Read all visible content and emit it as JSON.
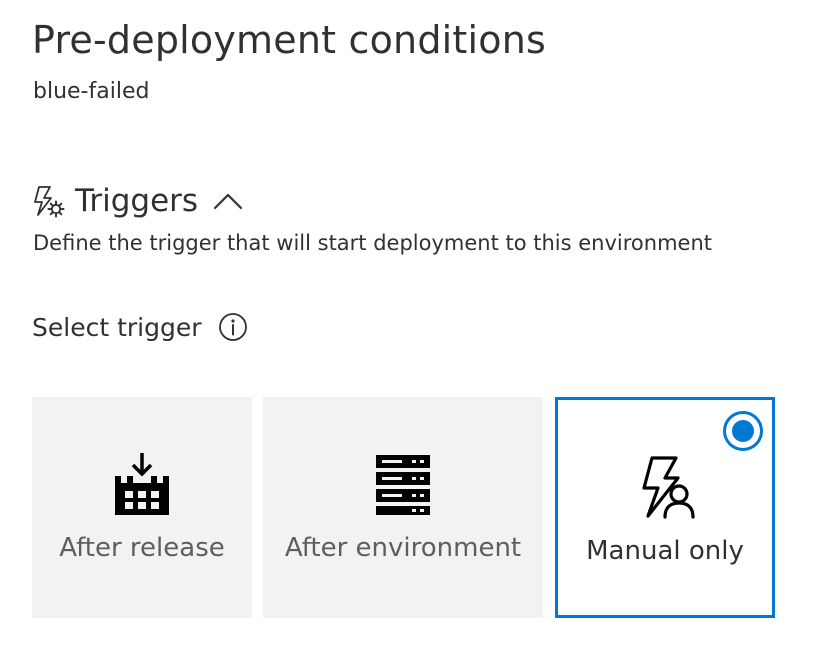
{
  "panel": {
    "title": "Pre-deployment conditions",
    "subtitle": "blue-failed"
  },
  "triggers_section": {
    "icon": "lightning-gear-icon",
    "title": "Triggers",
    "expanded": true,
    "description": "Define the trigger that will start deployment to this environment",
    "select_label": "Select trigger",
    "options": [
      {
        "label": "After release",
        "icon": "release-download-icon",
        "selected": false
      },
      {
        "label": "After environment",
        "icon": "server-stack-icon",
        "selected": false
      },
      {
        "label": "Manual only",
        "icon": "lightning-person-icon",
        "selected": true
      }
    ]
  },
  "colors": {
    "accent": "#0078d4",
    "card_background": "#f3f2f1",
    "text": "#323130",
    "muted_text": "#605e5c"
  }
}
